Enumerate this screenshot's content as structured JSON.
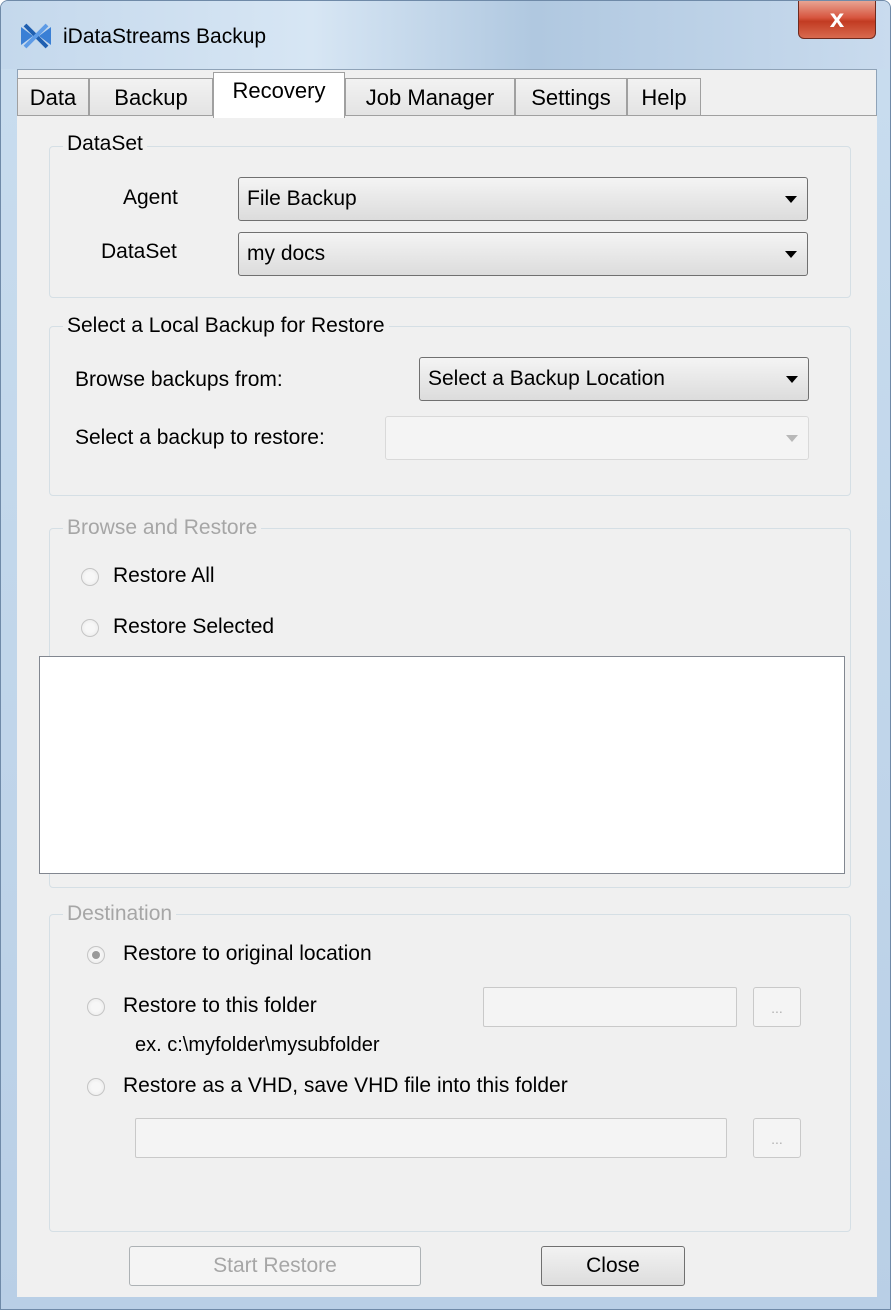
{
  "window": {
    "title": "iDataStreams Backup",
    "close_label": "x"
  },
  "tabs": [
    {
      "label": "Data"
    },
    {
      "label": "Backup"
    },
    {
      "label": "Recovery"
    },
    {
      "label": "Job Manager"
    },
    {
      "label": "Settings"
    },
    {
      "label": "Help"
    }
  ],
  "active_tab": "Recovery",
  "dataset_group": {
    "legend": "DataSet",
    "agent_label": "Agent",
    "agent_value": "File Backup",
    "dataset_label": "DataSet",
    "dataset_value": "my docs"
  },
  "local_backup_group": {
    "legend": "Select a Local Backup for Restore",
    "browse_label": "Browse backups from:",
    "browse_value": "Select a Backup Location",
    "select_label": "Select a backup to restore:",
    "select_value": ""
  },
  "browse_restore_group": {
    "legend": "Browse and Restore",
    "restore_all_label": "Restore All",
    "restore_selected_label": "Restore Selected"
  },
  "destination_group": {
    "legend": "Destination",
    "original_label": "Restore to original location",
    "folder_label": "Restore to this folder",
    "folder_hint": "ex. c:\\myfolder\\mysubfolder",
    "vhd_label": "Restore as a VHD, save VHD file into this folder",
    "browse_button_label": "...",
    "selected_option": "original"
  },
  "buttons": {
    "start_restore": "Start Restore",
    "close": "Close"
  }
}
